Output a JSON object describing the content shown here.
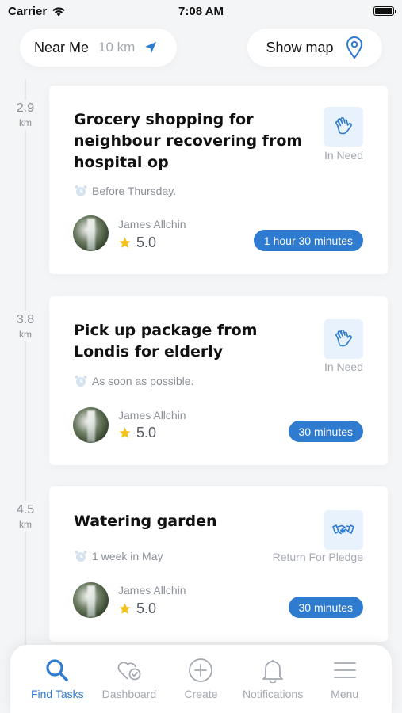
{
  "status_bar": {
    "carrier": "Carrier",
    "time": "7:08 AM"
  },
  "filter": {
    "near_me_label": "Near Me",
    "radius": "10 km",
    "show_map_label": "Show map"
  },
  "tasks": [
    {
      "distance": "2.9",
      "distance_unit": "km",
      "title": "Grocery shopping for neighbour recovering from hospital op",
      "category_label": "In Need",
      "category_icon": "hand-icon",
      "deadline": "Before Thursday.",
      "user_name": "James Allchin",
      "rating": "5.0",
      "duration": "1 hour 30 minutes"
    },
    {
      "distance": "3.8",
      "distance_unit": "km",
      "title": "Pick up package from Londis for elderly",
      "category_label": "In Need",
      "category_icon": "hand-icon",
      "deadline": "As soon as possible.",
      "user_name": "James Allchin",
      "rating": "5.0",
      "duration": "30 minutes"
    },
    {
      "distance": "4.5",
      "distance_unit": "km",
      "title": "Watering garden",
      "category_label": "Return For Pledge",
      "category_icon": "handshake-icon",
      "deadline": "1 week in May",
      "user_name": "James Allchin",
      "rating": "5.0",
      "duration": "30 minutes"
    }
  ],
  "tabs": [
    {
      "label": "Find Tasks",
      "icon": "search-icon",
      "active": true
    },
    {
      "label": "Dashboard",
      "icon": "heart-check-icon",
      "active": false
    },
    {
      "label": "Create",
      "icon": "plus-circle-icon",
      "active": false
    },
    {
      "label": "Notifications",
      "icon": "bell-icon",
      "active": false
    },
    {
      "label": "Menu",
      "icon": "hamburger-icon",
      "active": false
    }
  ],
  "colors": {
    "accent": "#2e7bd0",
    "background": "#f4f5f7",
    "muted_text": "#a4a9b1",
    "badge_bg": "#e8f2fc",
    "star": "#f2c21b"
  }
}
